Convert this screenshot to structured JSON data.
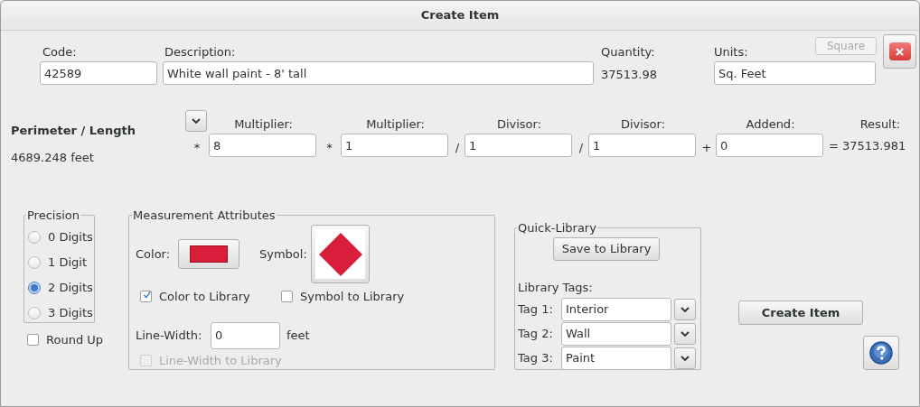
{
  "window": {
    "title": "Create Item"
  },
  "header": {
    "code": {
      "label": "Code:",
      "value": "42589"
    },
    "description": {
      "label": "Description:",
      "value": "White wall paint - 8' tall"
    },
    "quantity": {
      "label": "Quantity:",
      "value": "37513.98"
    },
    "units": {
      "label": "Units:",
      "value": "Sq. Feet"
    },
    "square_button": {
      "label": "Square",
      "disabled": true
    }
  },
  "formula": {
    "source": {
      "label": "Perimeter / Length",
      "value": "4689.248 feet"
    },
    "terms": [
      {
        "operator": "*",
        "label": "Multiplier:",
        "value": "8"
      },
      {
        "operator": "*",
        "label": "Multiplier:",
        "value": "1"
      },
      {
        "operator": "/",
        "label": "Divisor:",
        "value": "1"
      },
      {
        "operator": "/",
        "label": "Divisor:",
        "value": "1"
      },
      {
        "operator": "+",
        "label": "Addend:",
        "value": "0"
      }
    ],
    "result": {
      "label": "Result:",
      "operator": "=",
      "value": "37513.981"
    }
  },
  "precision": {
    "title": "Precision",
    "options": [
      {
        "label": "0 Digits",
        "selected": false
      },
      {
        "label": "1 Digit",
        "selected": false
      },
      {
        "label": "2 Digits",
        "selected": true
      },
      {
        "label": "3 Digits",
        "selected": false
      }
    ],
    "round_up": {
      "label": "Round Up",
      "checked": false
    }
  },
  "measurement": {
    "title": "Measurement Attributes",
    "color": {
      "label": "Color:",
      "color": "#d81e3a"
    },
    "symbol": {
      "label": "Symbol:"
    },
    "checkboxes": [
      {
        "label": "Color to Library",
        "checked": true,
        "disabled": false
      },
      {
        "label": "Symbol to Library",
        "checked": false,
        "disabled": false
      }
    ],
    "line_width": {
      "label": "Line-Width:",
      "value": "0",
      "unit": "feet"
    },
    "line_width_to_library": {
      "label": "Line-Width to Library",
      "checked": false,
      "disabled": true
    }
  },
  "quick_library": {
    "title": "Quick-Library",
    "save_button": "Save to Library",
    "tags_label": "Library Tags:",
    "tags": [
      {
        "label": "Tag 1:",
        "value": "Interior"
      },
      {
        "label": "Tag 2:",
        "value": "Wall"
      },
      {
        "label": "Tag 3:",
        "value": "Paint"
      }
    ]
  },
  "create_button": "Create Item"
}
